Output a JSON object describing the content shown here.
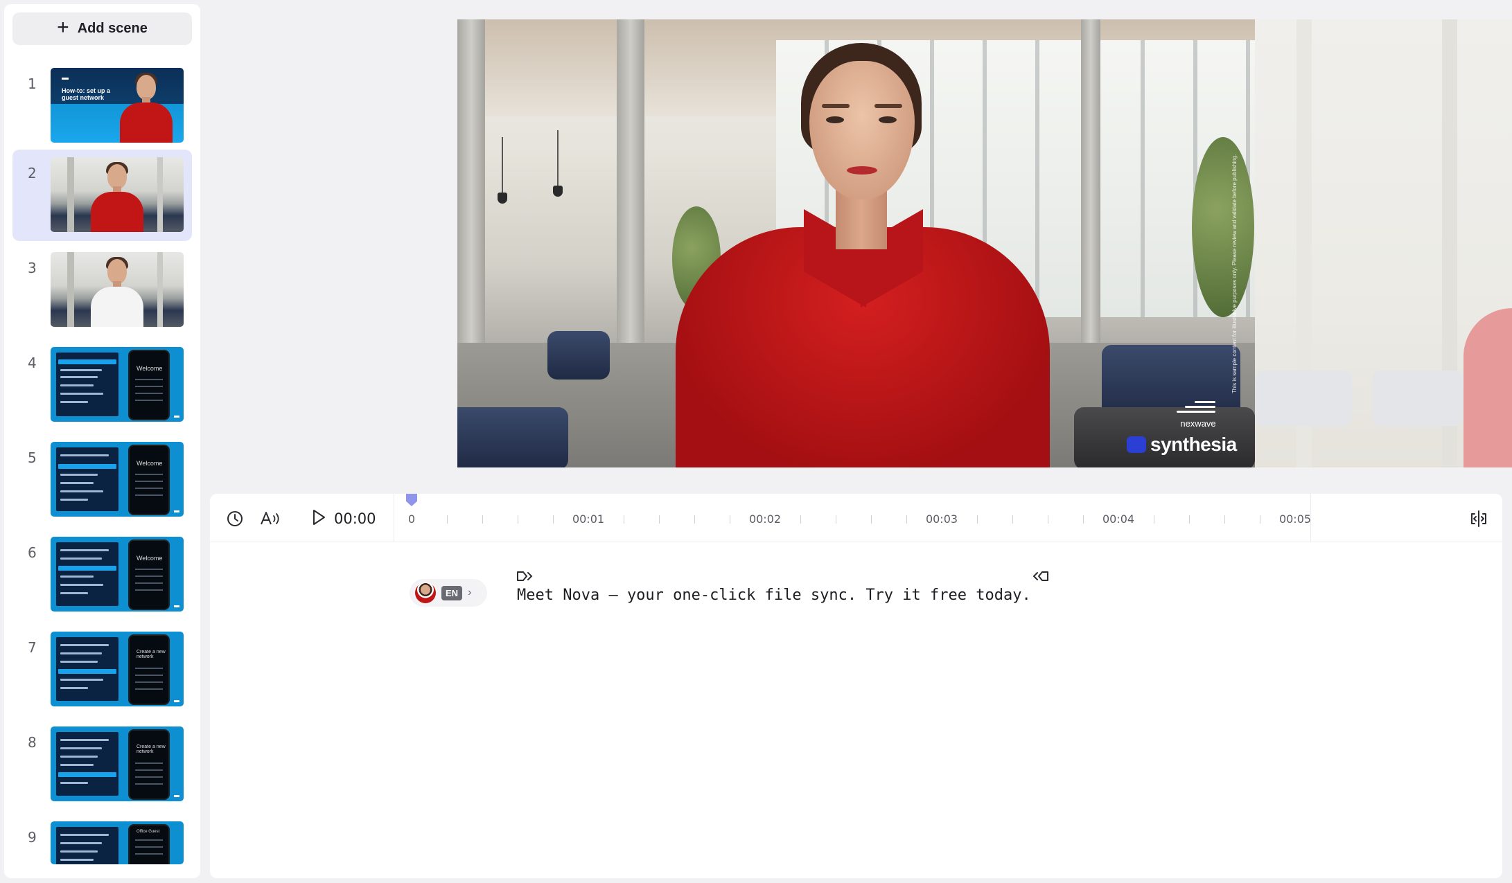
{
  "scene_panel": {
    "add_scene_label": "Add scene",
    "scenes": [
      {
        "number": "1",
        "title": "How-to: set up a guest network",
        "type": "intro"
      },
      {
        "number": "2",
        "type": "office-avatar",
        "active": true
      },
      {
        "number": "3",
        "type": "office-avatar-white"
      },
      {
        "number": "4",
        "type": "app",
        "phone_text": "Welcome"
      },
      {
        "number": "5",
        "type": "app",
        "phone_text": "Welcome"
      },
      {
        "number": "6",
        "type": "app",
        "phone_text": "Welcome"
      },
      {
        "number": "7",
        "type": "app",
        "phone_text": "Create a new network"
      },
      {
        "number": "8",
        "type": "app",
        "phone_text": "Create a new network"
      },
      {
        "number": "9",
        "type": "app",
        "phone_text": "Office Guest"
      }
    ]
  },
  "preview": {
    "brand_name": "nexwave",
    "watermark": "synthesia",
    "disclaimer": "This is sample content for illustrative purposes only. Please review and validate before publishing."
  },
  "timeline": {
    "current_time": "00:00",
    "ticks": [
      "0",
      "00:01",
      "00:02",
      "00:03",
      "00:04",
      "00:05"
    ],
    "playhead_position_seconds": 0
  },
  "script": {
    "voice_language": "EN",
    "text": "Meet Nova — your one-click file sync. Try it free today."
  },
  "colors": {
    "accent": "#8f95e8",
    "active_scene_bg": "#e3e6fb",
    "brand_blue": "#1aa7ec",
    "shirt_red": "#c21616"
  },
  "icons": {
    "add": "plus-icon",
    "duration": "clock-icon",
    "pronunciation": "voice-a-icon",
    "play": "play-icon",
    "split": "split-scene-icon",
    "marker_start": "marker-start-icon",
    "marker_end": "marker-end-icon"
  }
}
